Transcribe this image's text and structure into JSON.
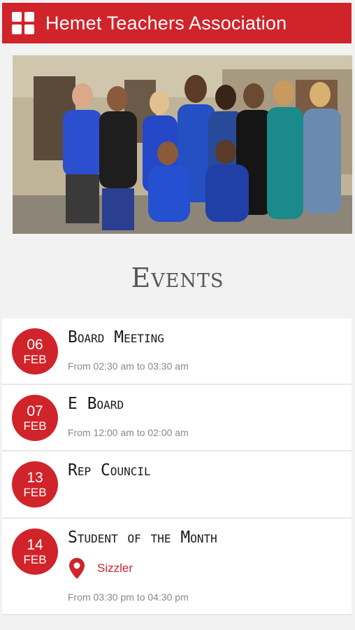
{
  "header": {
    "title": "Hemet Teachers Association",
    "accent": "#d1232a",
    "menu_icon": "grid-menu-icon"
  },
  "events_section": {
    "heading": "Events"
  },
  "events": [
    {
      "day": "06",
      "month": "FEB",
      "title": "Board Meeting",
      "time": "From 02:30 am to 03:30 am"
    },
    {
      "day": "07",
      "month": "FEB",
      "title": "E Board",
      "time": "From 12:00 am to 02:00 am"
    },
    {
      "day": "13",
      "month": "FEB",
      "title": "Rep Council"
    },
    {
      "day": "14",
      "month": "FEB",
      "title": "Student of the Month",
      "location": "Sizzler",
      "time": "From 03:30 pm to 04:30 pm"
    }
  ]
}
